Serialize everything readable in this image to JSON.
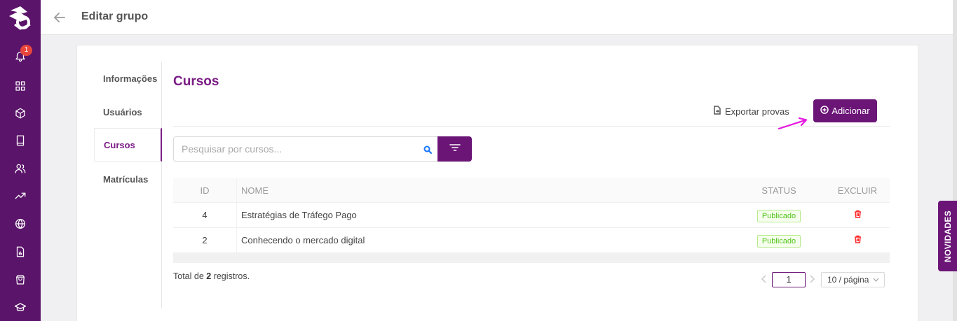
{
  "header": {
    "title": "Editar grupo"
  },
  "sidebar": {
    "notification_count": "1"
  },
  "side_nav": [
    {
      "label": "Informações"
    },
    {
      "label": "Usuários"
    },
    {
      "label": "Cursos"
    },
    {
      "label": "Matrículas"
    }
  ],
  "section": {
    "title": "Cursos",
    "export_label": "Exportar provas",
    "add_label": "Adicionar"
  },
  "search": {
    "placeholder": "Pesquisar por cursos..."
  },
  "table": {
    "headers": {
      "id": "ID",
      "name": "NOME",
      "status": "STATUS",
      "delete": "EXCLUIR"
    },
    "rows": [
      {
        "id": "4",
        "name": "Estratégias de Tráfego Pago",
        "status": "Publicado"
      },
      {
        "id": "2",
        "name": "Conhecendo o mercado digital",
        "status": "Publicado"
      }
    ]
  },
  "footer": {
    "total_prefix": "Total de ",
    "total_count": "2",
    "total_suffix": " registros.",
    "current_page": "1",
    "page_size": "10 / página"
  },
  "novidades_label": "NOVIDADES",
  "colors": {
    "brand": "#6b1577",
    "sidebar": "#5a1469",
    "status_green": "#52c41a",
    "delete_red": "#ff2a2a",
    "annotation_arrow": "#e616e0"
  }
}
